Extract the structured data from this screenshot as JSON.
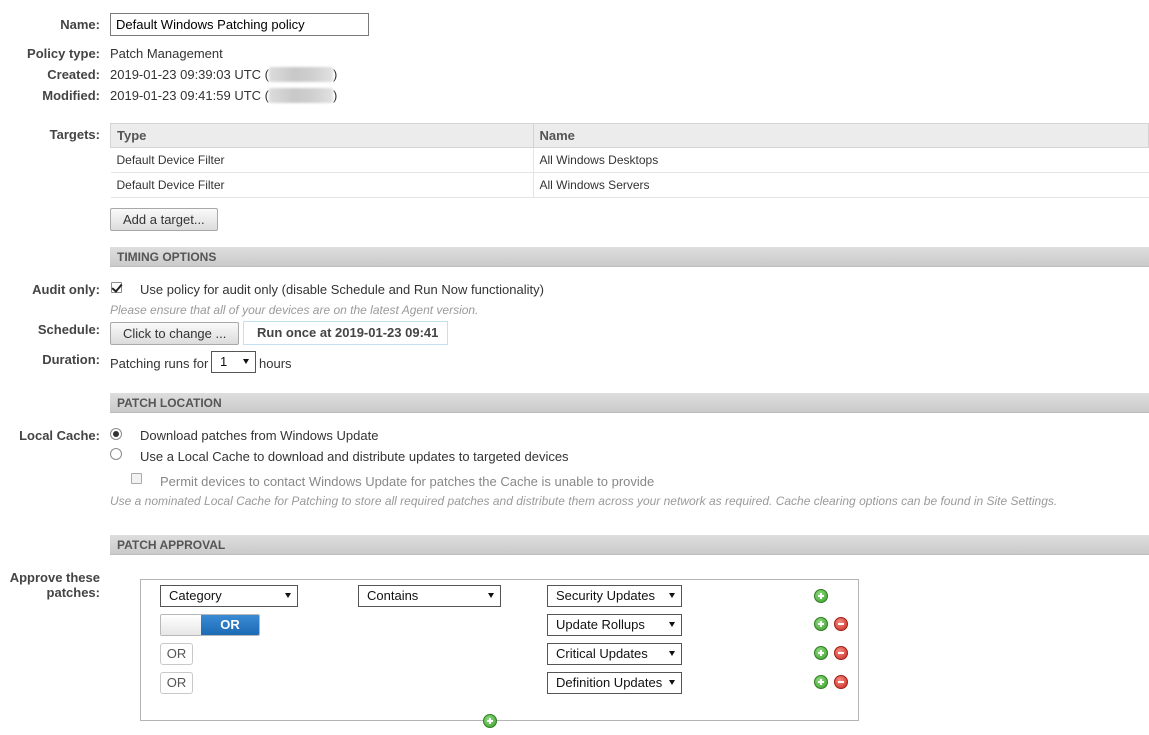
{
  "policy": {
    "name_label": "Name:",
    "name_value": "Default Windows Patching policy",
    "type_label": "Policy type:",
    "type_value": "Patch Management",
    "created_label": "Created:",
    "created_value": "2019-01-23 09:39:03 UTC (",
    "modified_label": "Modified:",
    "modified_value": "2019-01-23 09:41:59 UTC (",
    "close_paren": ")"
  },
  "targets": {
    "label": "Targets:",
    "columns": [
      "Type",
      "Name"
    ],
    "rows": [
      [
        "Default Device Filter",
        "All Windows Desktops"
      ],
      [
        "Default Device Filter",
        "All Windows Servers"
      ]
    ],
    "add_button": "Add a target..."
  },
  "timing": {
    "section_title": "TIMING OPTIONS",
    "audit_label": "Audit only:",
    "audit_text": "Use policy for audit only (disable Schedule and Run Now functionality)",
    "audit_hint": "Please ensure that all of your devices are on the latest Agent version.",
    "schedule_label": "Schedule:",
    "schedule_button": "Click to change ...",
    "schedule_value": "Run once at 2019-01-23 09:41",
    "duration_label": "Duration:",
    "duration_prefix": "Patching runs for",
    "duration_value": "1",
    "duration_suffix": "hours"
  },
  "location": {
    "section_title": "PATCH LOCATION",
    "cache_label": "Local Cache:",
    "option_windows_update": "Download patches from Windows Update",
    "option_local_cache": "Use a Local Cache to download and distribute updates to targeted devices",
    "permit_text": "Permit devices to contact Windows Update for patches the Cache is unable to provide",
    "hint": "Use a nominated Local Cache for Patching to store all required patches and distribute them across your network as required. Cache clearing options can be found in Site Settings."
  },
  "approval": {
    "section_title": "PATCH APPROVAL",
    "label_line1": "Approve these",
    "label_line2": "patches:",
    "field": "Category",
    "operator": "Contains",
    "toggle_label": "OR",
    "or_label": "OR",
    "values": [
      "Security Updates",
      "Update Rollups",
      "Critical Updates",
      "Definition Updates"
    ]
  },
  "icons": {
    "add": "add-circle-icon",
    "remove": "remove-circle-icon",
    "dropdown": "chevron-down-icon"
  },
  "colors": {
    "toggle_blue": "#2a78c4",
    "section_gray": "#d2d2d2",
    "add_green": "#3b9c2b",
    "remove_red": "#c8291e"
  }
}
